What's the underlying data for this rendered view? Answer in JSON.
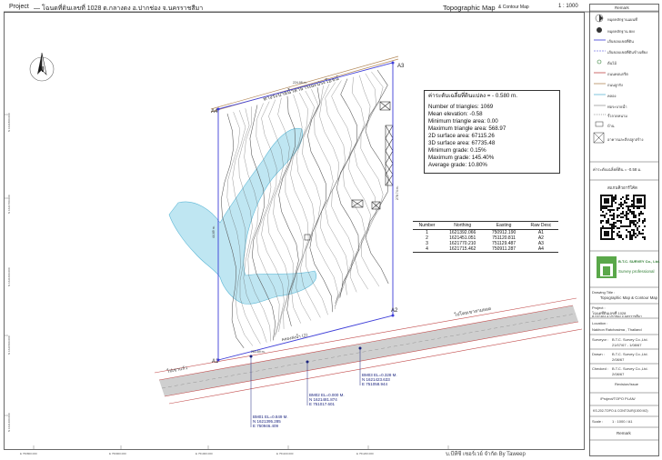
{
  "header": {
    "project_prefix": "Project",
    "project_title": "— โฉนดที่ดินเลขที่ 1028 ต.กลางดง อ.ปากช่อง จ.นครราชสีมา",
    "map_title": "Topographic Map",
    "map_title_suffix": "& Contour Map",
    "scale": "1 : 1000"
  },
  "map": {
    "corner_labels": [
      "A1",
      "A2",
      "A3",
      "A4"
    ],
    "boundary_label_top": "224.98 m.",
    "boundary_label_right": "278.74 m.",
    "boundary_label_left": "44.69 m.",
    "boundary_label_bottom": "283.89 m.",
    "road_label_top": "ทางระบายน้ำสาธารณะประโยชน์",
    "road_label_bottom_left": "ไปเขาแก้ว",
    "road_label_bottom_right": "ไปโคยเขาสามยอด",
    "canal_label": "คลองส่งน้ำ (2)"
  },
  "benchmarks": [
    {
      "id": "bm1",
      "title": "BM01 EL=0.849 M.",
      "n": "N 1621395.285",
      "e": "E 750946.409"
    },
    {
      "id": "bm2",
      "title": "BM02 EL=0.000 M.",
      "n": "N 1621481.874",
      "e": "E 751017.601"
    },
    {
      "id": "bm3",
      "title": "BM03 EL=0.328 M.",
      "n": "N 1621423.633",
      "e": "E 751058.944"
    }
  ],
  "stats": {
    "title": "ค่าระดับเฉลี่ยที่ดินแปลง = - 0.580 m.",
    "lines": [
      "Number of triangles: 1069",
      "Mean elevation: -0.58",
      "Minimum triangle area: 0.00",
      "Maximum triangle area: 568.97",
      "2D surface area: 67115.26",
      "3D surface area: 67735.48",
      "Minimum grade: 0.15%",
      "Maximum grade: 145.40%",
      "Average grade: 10.80%"
    ]
  },
  "point_table": {
    "headers": [
      "Number",
      "Northing",
      "Easting",
      "Raw Desc"
    ],
    "rows": [
      [
        "1",
        "1621392.066",
        "750912.190",
        "A1"
      ],
      [
        "2",
        "1621451.051",
        "751120.811",
        "A2"
      ],
      [
        "3",
        "1621770.210",
        "751129.487",
        "A3"
      ],
      [
        "4",
        "1621715.462",
        "750911.287",
        "A4"
      ]
    ]
  },
  "title_block": {
    "remark_header": "Remark",
    "legend_items": [
      "หมุดหลักฐานแผนที่",
      "หมุดหลักฐาน BM",
      "เส้นขอบเขตที่ดิน",
      "เส้นขอบเขตที่ดินข้างเคียง",
      "ต้นไม้",
      "ถนนคอนกรีต",
      "ถนนลูกรัง",
      "คลอง",
      "ท่อระบายน้ำ",
      "รั้วลวดหนาม",
      "บ้าน",
      "อาคารและสิ่งปลูกสร้าง"
    ],
    "elevation_note": "ค่าระดับเฉลี่ยที่ดิน = -0.58 ม.",
    "qr_label": "สแกนคิวอาร์โค้ด",
    "company_name": "B.T.C. SURVEY Co., Ltd.",
    "company_tagline": "Survey professional",
    "drawing_title_label": "Drawing Title :",
    "drawing_title": "Topographic Map & Contour Map",
    "project_label": "Project :",
    "project_value": "โฉนดที่ดินเลขที่ 1028",
    "project_value2": "ต.กลางดง อ.ปากช่อง จ.นครราชสีมา",
    "location_label": "Location :",
    "location_value": "Nakhon Ratchasima , Thailand",
    "surveyor_label": "Surveyor :",
    "surveyor_value": "B.T.C. Survey Co.,Ltd.",
    "surveyor_date": "21/07/67 - 1/08/67",
    "drawn_label": "Drawn :",
    "drawn_value": "B.T.C. Survey Co.,Ltd.",
    "drawn_date": "2/08/67",
    "checked_label": "Checked :",
    "checked_value": "B.T.C. Survey Co.,Ltd.",
    "checked_date": "2/08/67",
    "revision_label": "Revision/Issue",
    "file_no": "/Project/TOPO PLAN/",
    "file_no2": "KS-202-TOPO & CONTOUR(1000 M2)",
    "scale_label": "Scale :",
    "scale_value": "1 : 1000 / A1",
    "remark_footer": "Remark"
  },
  "grid": {
    "easting_labels": [
      "E 750800.000",
      "E 750900.000",
      "E 751000.000",
      "E 751100.000",
      "E 751200.000"
    ],
    "northing_labels": [
      "N 1621800.000",
      "N 1621700.000",
      "N 1621600.000",
      "N 1621500.000",
      "N 1621400.000"
    ]
  },
  "footer_watermark": "บ.บีทีซี เซอร์เวย์ จำกัด  By Taweep",
  "colors": {
    "boundary": "#3d3dd8",
    "water_fill": "#bfe6f2",
    "water_stroke": "#5fb8d6",
    "contour": "#555555",
    "road_fill": "#c9c9c9",
    "road_edge": "#c24a4a",
    "logo_green": "#5aa84a"
  }
}
